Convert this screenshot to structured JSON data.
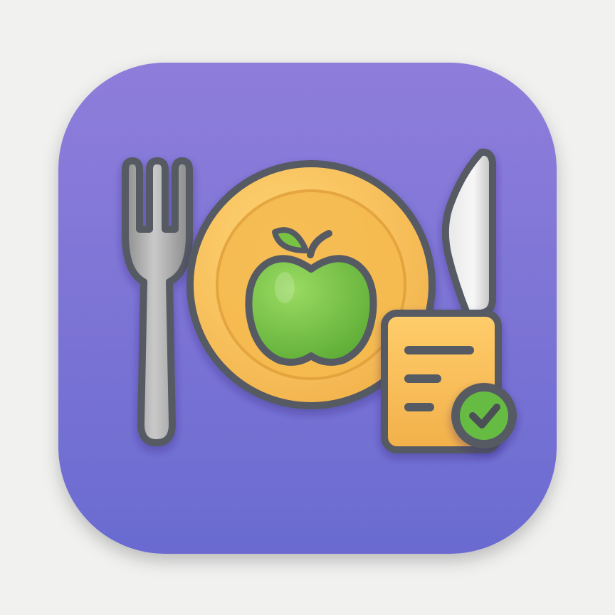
{
  "icon": {
    "subject": "meal-plan-app-icon",
    "elements": [
      "fork-icon",
      "plate-icon",
      "apple-icon",
      "knife-icon",
      "checklist-icon",
      "checkmark-icon"
    ]
  },
  "colors": {
    "background": "#f1f1f0",
    "tile_top": "#8f7ddb",
    "tile_bottom": "#6a6bd0",
    "outline": "#565a63",
    "plate": "#f7c25a",
    "plate_inner": "#f5bb50",
    "apple": "#74c244",
    "leaf": "#78c442",
    "silver": "#b2b2b2",
    "note": "#f6bc56",
    "check_badge": "#66bb42"
  }
}
